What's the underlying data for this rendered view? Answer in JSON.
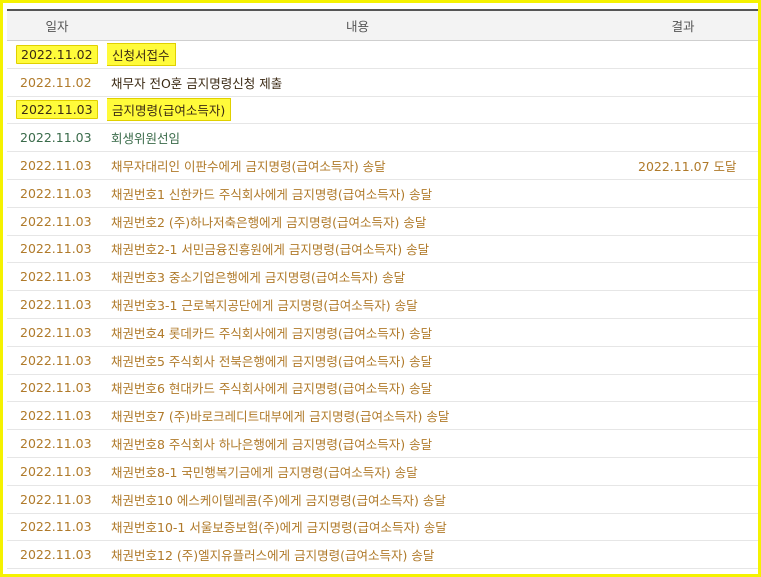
{
  "header": {
    "date": "일자",
    "content": "내용",
    "result": "결과"
  },
  "rows": [
    {
      "date": "2022.11.02",
      "content": "신청서접수",
      "result": ""
    },
    {
      "date": "2022.11.02",
      "content": "채무자 전O훈 금지명령신청 제출",
      "result": ""
    },
    {
      "date": "2022.11.03",
      "content": "금지명령(급여소득자)",
      "result": ""
    },
    {
      "date": "2022.11.03",
      "content": "회생위원선임",
      "result": ""
    },
    {
      "date": "2022.11.03",
      "content": "채무자대리인 이판수에게 금지명령(급여소득자) 송달",
      "result": "2022.11.07 도달"
    },
    {
      "date": "2022.11.03",
      "content": "채권번호1 신한카드 주식회사에게 금지명령(급여소득자) 송달",
      "result": ""
    },
    {
      "date": "2022.11.03",
      "content": "채권번호2 (주)하나저축은행에게 금지명령(급여소득자) 송달",
      "result": ""
    },
    {
      "date": "2022.11.03",
      "content": "채권번호2-1 서민금융진흥원에게 금지명령(급여소득자) 송달",
      "result": ""
    },
    {
      "date": "2022.11.03",
      "content": "채권번호3 중소기업은행에게 금지명령(급여소득자) 송달",
      "result": ""
    },
    {
      "date": "2022.11.03",
      "content": "채권번호3-1 근로복지공단에게 금지명령(급여소득자) 송달",
      "result": ""
    },
    {
      "date": "2022.11.03",
      "content": "채권번호4 롯데카드 주식회사에게 금지명령(급여소득자) 송달",
      "result": ""
    },
    {
      "date": "2022.11.03",
      "content": "채권번호5 주식회사 전북은행에게 금지명령(급여소득자) 송달",
      "result": ""
    },
    {
      "date": "2022.11.03",
      "content": "채권번호6 현대카드 주식회사에게 금지명령(급여소득자) 송달",
      "result": ""
    },
    {
      "date": "2022.11.03",
      "content": "채권번호7 (주)바로크레디트대부에게 금지명령(급여소득자) 송달",
      "result": ""
    },
    {
      "date": "2022.11.03",
      "content": "채권번호8 주식회사 하나은행에게 금지명령(급여소득자) 송달",
      "result": ""
    },
    {
      "date": "2022.11.03",
      "content": "채권번호8-1 국민행복기금에게 금지명령(급여소득자) 송달",
      "result": ""
    },
    {
      "date": "2022.11.03",
      "content": "채권번호10 에스케이텔레콤(주)에게 금지명령(급여소득자) 송달",
      "result": ""
    },
    {
      "date": "2022.11.03",
      "content": "채권번호10-1 서울보증보험(주)에게 금지명령(급여소득자) 송달",
      "result": ""
    },
    {
      "date": "2022.11.03",
      "content": "채권번호12 (주)엘지유플러스에게 금지명령(급여소득자) 송달",
      "result": ""
    }
  ]
}
